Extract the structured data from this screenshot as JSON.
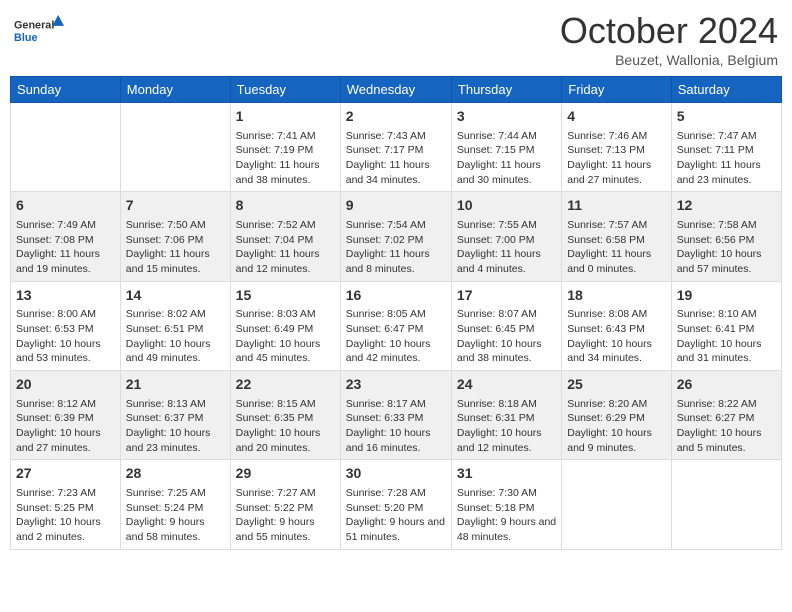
{
  "header": {
    "logo_general": "General",
    "logo_blue": "Blue",
    "month": "October 2024",
    "location": "Beuzet, Wallonia, Belgium"
  },
  "weekdays": [
    "Sunday",
    "Monday",
    "Tuesday",
    "Wednesday",
    "Thursday",
    "Friday",
    "Saturday"
  ],
  "weeks": [
    [
      {
        "day": "",
        "sunrise": "",
        "sunset": "",
        "daylight": ""
      },
      {
        "day": "",
        "sunrise": "",
        "sunset": "",
        "daylight": ""
      },
      {
        "day": "1",
        "sunrise": "Sunrise: 7:41 AM",
        "sunset": "Sunset: 7:19 PM",
        "daylight": "Daylight: 11 hours and 38 minutes."
      },
      {
        "day": "2",
        "sunrise": "Sunrise: 7:43 AM",
        "sunset": "Sunset: 7:17 PM",
        "daylight": "Daylight: 11 hours and 34 minutes."
      },
      {
        "day": "3",
        "sunrise": "Sunrise: 7:44 AM",
        "sunset": "Sunset: 7:15 PM",
        "daylight": "Daylight: 11 hours and 30 minutes."
      },
      {
        "day": "4",
        "sunrise": "Sunrise: 7:46 AM",
        "sunset": "Sunset: 7:13 PM",
        "daylight": "Daylight: 11 hours and 27 minutes."
      },
      {
        "day": "5",
        "sunrise": "Sunrise: 7:47 AM",
        "sunset": "Sunset: 7:11 PM",
        "daylight": "Daylight: 11 hours and 23 minutes."
      }
    ],
    [
      {
        "day": "6",
        "sunrise": "Sunrise: 7:49 AM",
        "sunset": "Sunset: 7:08 PM",
        "daylight": "Daylight: 11 hours and 19 minutes."
      },
      {
        "day": "7",
        "sunrise": "Sunrise: 7:50 AM",
        "sunset": "Sunset: 7:06 PM",
        "daylight": "Daylight: 11 hours and 15 minutes."
      },
      {
        "day": "8",
        "sunrise": "Sunrise: 7:52 AM",
        "sunset": "Sunset: 7:04 PM",
        "daylight": "Daylight: 11 hours and 12 minutes."
      },
      {
        "day": "9",
        "sunrise": "Sunrise: 7:54 AM",
        "sunset": "Sunset: 7:02 PM",
        "daylight": "Daylight: 11 hours and 8 minutes."
      },
      {
        "day": "10",
        "sunrise": "Sunrise: 7:55 AM",
        "sunset": "Sunset: 7:00 PM",
        "daylight": "Daylight: 11 hours and 4 minutes."
      },
      {
        "day": "11",
        "sunrise": "Sunrise: 7:57 AM",
        "sunset": "Sunset: 6:58 PM",
        "daylight": "Daylight: 11 hours and 0 minutes."
      },
      {
        "day": "12",
        "sunrise": "Sunrise: 7:58 AM",
        "sunset": "Sunset: 6:56 PM",
        "daylight": "Daylight: 10 hours and 57 minutes."
      }
    ],
    [
      {
        "day": "13",
        "sunrise": "Sunrise: 8:00 AM",
        "sunset": "Sunset: 6:53 PM",
        "daylight": "Daylight: 10 hours and 53 minutes."
      },
      {
        "day": "14",
        "sunrise": "Sunrise: 8:02 AM",
        "sunset": "Sunset: 6:51 PM",
        "daylight": "Daylight: 10 hours and 49 minutes."
      },
      {
        "day": "15",
        "sunrise": "Sunrise: 8:03 AM",
        "sunset": "Sunset: 6:49 PM",
        "daylight": "Daylight: 10 hours and 45 minutes."
      },
      {
        "day": "16",
        "sunrise": "Sunrise: 8:05 AM",
        "sunset": "Sunset: 6:47 PM",
        "daylight": "Daylight: 10 hours and 42 minutes."
      },
      {
        "day": "17",
        "sunrise": "Sunrise: 8:07 AM",
        "sunset": "Sunset: 6:45 PM",
        "daylight": "Daylight: 10 hours and 38 minutes."
      },
      {
        "day": "18",
        "sunrise": "Sunrise: 8:08 AM",
        "sunset": "Sunset: 6:43 PM",
        "daylight": "Daylight: 10 hours and 34 minutes."
      },
      {
        "day": "19",
        "sunrise": "Sunrise: 8:10 AM",
        "sunset": "Sunset: 6:41 PM",
        "daylight": "Daylight: 10 hours and 31 minutes."
      }
    ],
    [
      {
        "day": "20",
        "sunrise": "Sunrise: 8:12 AM",
        "sunset": "Sunset: 6:39 PM",
        "daylight": "Daylight: 10 hours and 27 minutes."
      },
      {
        "day": "21",
        "sunrise": "Sunrise: 8:13 AM",
        "sunset": "Sunset: 6:37 PM",
        "daylight": "Daylight: 10 hours and 23 minutes."
      },
      {
        "day": "22",
        "sunrise": "Sunrise: 8:15 AM",
        "sunset": "Sunset: 6:35 PM",
        "daylight": "Daylight: 10 hours and 20 minutes."
      },
      {
        "day": "23",
        "sunrise": "Sunrise: 8:17 AM",
        "sunset": "Sunset: 6:33 PM",
        "daylight": "Daylight: 10 hours and 16 minutes."
      },
      {
        "day": "24",
        "sunrise": "Sunrise: 8:18 AM",
        "sunset": "Sunset: 6:31 PM",
        "daylight": "Daylight: 10 hours and 12 minutes."
      },
      {
        "day": "25",
        "sunrise": "Sunrise: 8:20 AM",
        "sunset": "Sunset: 6:29 PM",
        "daylight": "Daylight: 10 hours and 9 minutes."
      },
      {
        "day": "26",
        "sunrise": "Sunrise: 8:22 AM",
        "sunset": "Sunset: 6:27 PM",
        "daylight": "Daylight: 10 hours and 5 minutes."
      }
    ],
    [
      {
        "day": "27",
        "sunrise": "Sunrise: 7:23 AM",
        "sunset": "Sunset: 5:25 PM",
        "daylight": "Daylight: 10 hours and 2 minutes."
      },
      {
        "day": "28",
        "sunrise": "Sunrise: 7:25 AM",
        "sunset": "Sunset: 5:24 PM",
        "daylight": "Daylight: 9 hours and 58 minutes."
      },
      {
        "day": "29",
        "sunrise": "Sunrise: 7:27 AM",
        "sunset": "Sunset: 5:22 PM",
        "daylight": "Daylight: 9 hours and 55 minutes."
      },
      {
        "day": "30",
        "sunrise": "Sunrise: 7:28 AM",
        "sunset": "Sunset: 5:20 PM",
        "daylight": "Daylight: 9 hours and 51 minutes."
      },
      {
        "day": "31",
        "sunrise": "Sunrise: 7:30 AM",
        "sunset": "Sunset: 5:18 PM",
        "daylight": "Daylight: 9 hours and 48 minutes."
      },
      {
        "day": "",
        "sunrise": "",
        "sunset": "",
        "daylight": ""
      },
      {
        "day": "",
        "sunrise": "",
        "sunset": "",
        "daylight": ""
      }
    ]
  ]
}
